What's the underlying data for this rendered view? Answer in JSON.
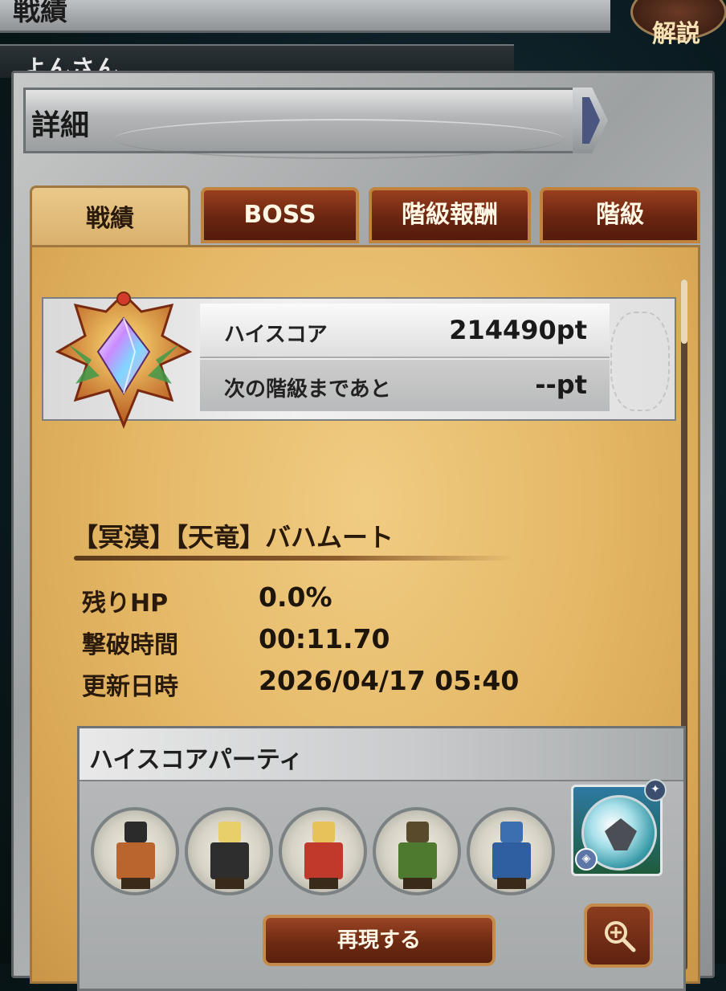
{
  "background": {
    "header_title": "戦績",
    "help_button_label": "解説",
    "player_row_text": "よんさん"
  },
  "modal": {
    "title": "詳細",
    "tabs": [
      {
        "label": "戦績",
        "active": true
      },
      {
        "label": "BOSS",
        "active": false
      },
      {
        "label": "階級報酬",
        "active": false
      },
      {
        "label": "階級",
        "active": false
      }
    ]
  },
  "score": {
    "rank_icon": "crystal-rank-emblem",
    "highscore_label": "ハイスコア",
    "highscore_value": "214490pt",
    "next_rank_label": "次の階級まであと",
    "next_rank_value": "--pt"
  },
  "boss": {
    "name": "【冥漠】【天竜】バハムート",
    "stats": [
      {
        "label": "残りHP",
        "value": "0.0%"
      },
      {
        "label": "撃破時間",
        "value": "00:11.70"
      },
      {
        "label": "更新日時",
        "value": "2026/04/17 05:40"
      }
    ]
  },
  "party": {
    "title": "ハイスコアパーティ",
    "members": [
      {
        "name": "party-member-1",
        "hair": "#2b2b2b",
        "outfit": "#b9652d"
      },
      {
        "name": "party-member-2",
        "hair": "#e8cf6a",
        "outfit": "#2e2e2e"
      },
      {
        "name": "party-member-3",
        "hair": "#e7c25a",
        "outfit": "#c0392b"
      },
      {
        "name": "party-member-4",
        "hair": "#5a4a2c",
        "outfit": "#4e7a2f"
      },
      {
        "name": "party-member-5",
        "hair": "#3b6fb0",
        "outfit": "#2f5f9e"
      }
    ],
    "summon_icon": "summon-orb-icon",
    "replay_button_label": "再現する",
    "zoom_icon": "magnify-plus-icon"
  },
  "colors": {
    "parchment": "#e4b765",
    "tab_inactive": "#6a2510",
    "tab_border": "#c1843f",
    "text_dark": "#2a1a0c"
  }
}
